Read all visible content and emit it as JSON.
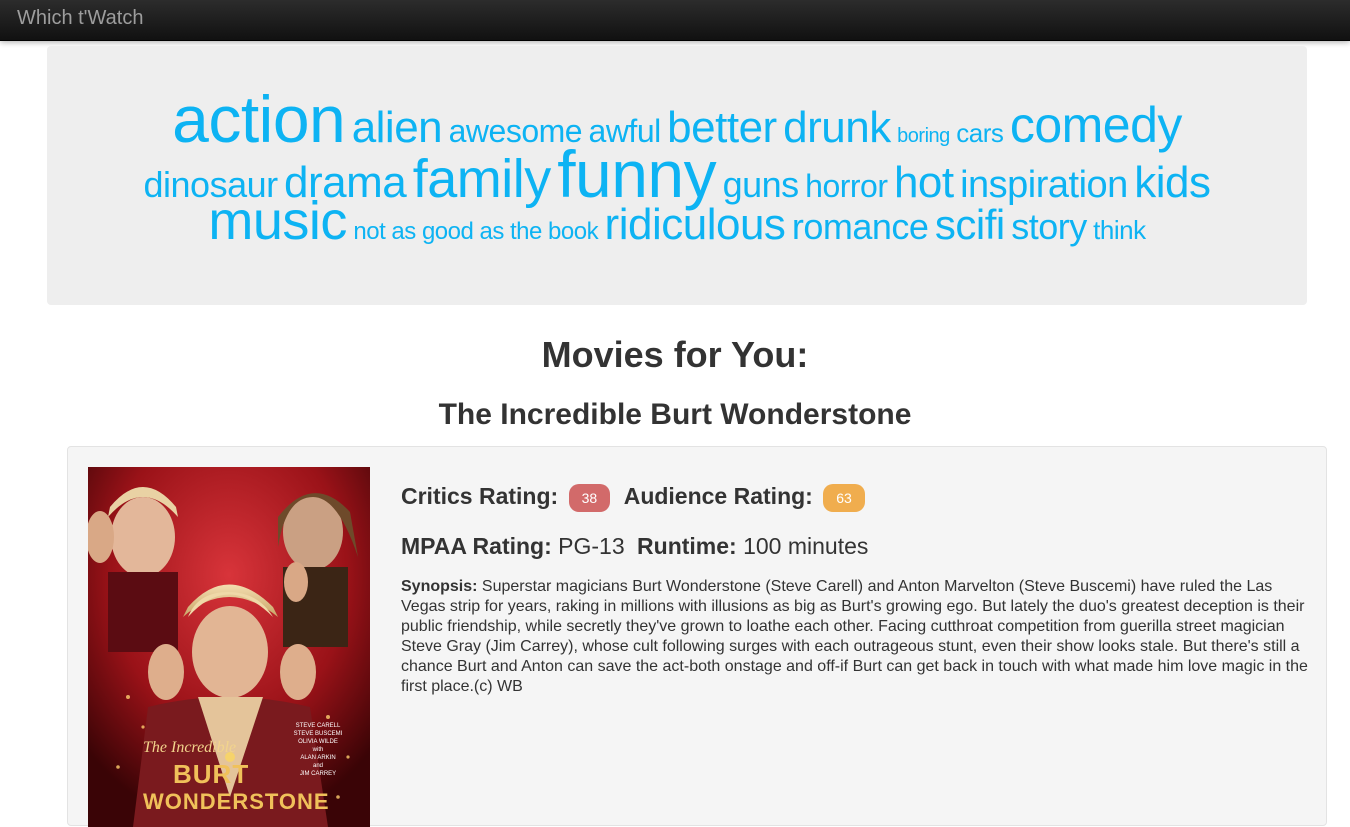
{
  "navbar": {
    "brand": "Which t'Watch"
  },
  "tags": [
    {
      "text": "action"
    },
    {
      "text": "alien"
    },
    {
      "text": "awesome"
    },
    {
      "text": "awful"
    },
    {
      "text": "better"
    },
    {
      "text": "drunk"
    },
    {
      "text": "boring"
    },
    {
      "text": "cars"
    },
    {
      "text": "comedy"
    },
    {
      "text": "dinosaur"
    },
    {
      "text": "drama"
    },
    {
      "text": "family"
    },
    {
      "text": "funny"
    },
    {
      "text": "guns"
    },
    {
      "text": "horror"
    },
    {
      "text": "hot"
    },
    {
      "text": "inspiration"
    },
    {
      "text": "kids"
    },
    {
      "text": "music"
    },
    {
      "text": "not as good as the book"
    },
    {
      "text": "ridiculous"
    },
    {
      "text": "romance"
    },
    {
      "text": "scifi"
    },
    {
      "text": "story"
    },
    {
      "text": "think"
    }
  ],
  "colors": {
    "tag": "#0db3f3",
    "critics_badge": "#d26a6a",
    "audience_badge": "#f0ad4e",
    "navbar": "#1b1b1b"
  },
  "heading": "Movies for You:",
  "movie": {
    "title": "The Incredible Burt Wonderstone",
    "critics_label": "Critics Rating:",
    "critics_value": "38",
    "audience_label": "Audience Rating:",
    "audience_value": "63",
    "mpaa_label": "MPAA Rating:",
    "mpaa_value": "PG-13",
    "runtime_label": "Runtime:",
    "runtime_value": "100 minutes",
    "synopsis_label": "Synopsis:",
    "synopsis": "Superstar magicians Burt Wonderstone (Steve Carell) and Anton Marvelton (Steve Buscemi) have ruled the Las Vegas strip for years, raking in millions with illusions as big as Burt's growing ego. But lately the duo's greatest deception is their public friendship, while secretly they've grown to loathe each other. Facing cutthroat competition from guerilla street magician Steve Gray (Jim Carrey), whose cult following surges with each outrageous stunt, even their show looks stale. But there's still a chance Burt and Anton can save the act-both onstage and off-if Burt can get back in touch with what made him love magic in the first place.(c) WB",
    "poster": {
      "title_line1": "The Incredible",
      "title_line2": "BURT",
      "title_line3": "WONDERSTONE",
      "credits": [
        "STEVE CARELL",
        "STEVE BUSCEMI",
        "OLIVIA WILDE",
        "with",
        "ALAN ARKIN",
        "and",
        "JIM CARREY"
      ]
    }
  }
}
